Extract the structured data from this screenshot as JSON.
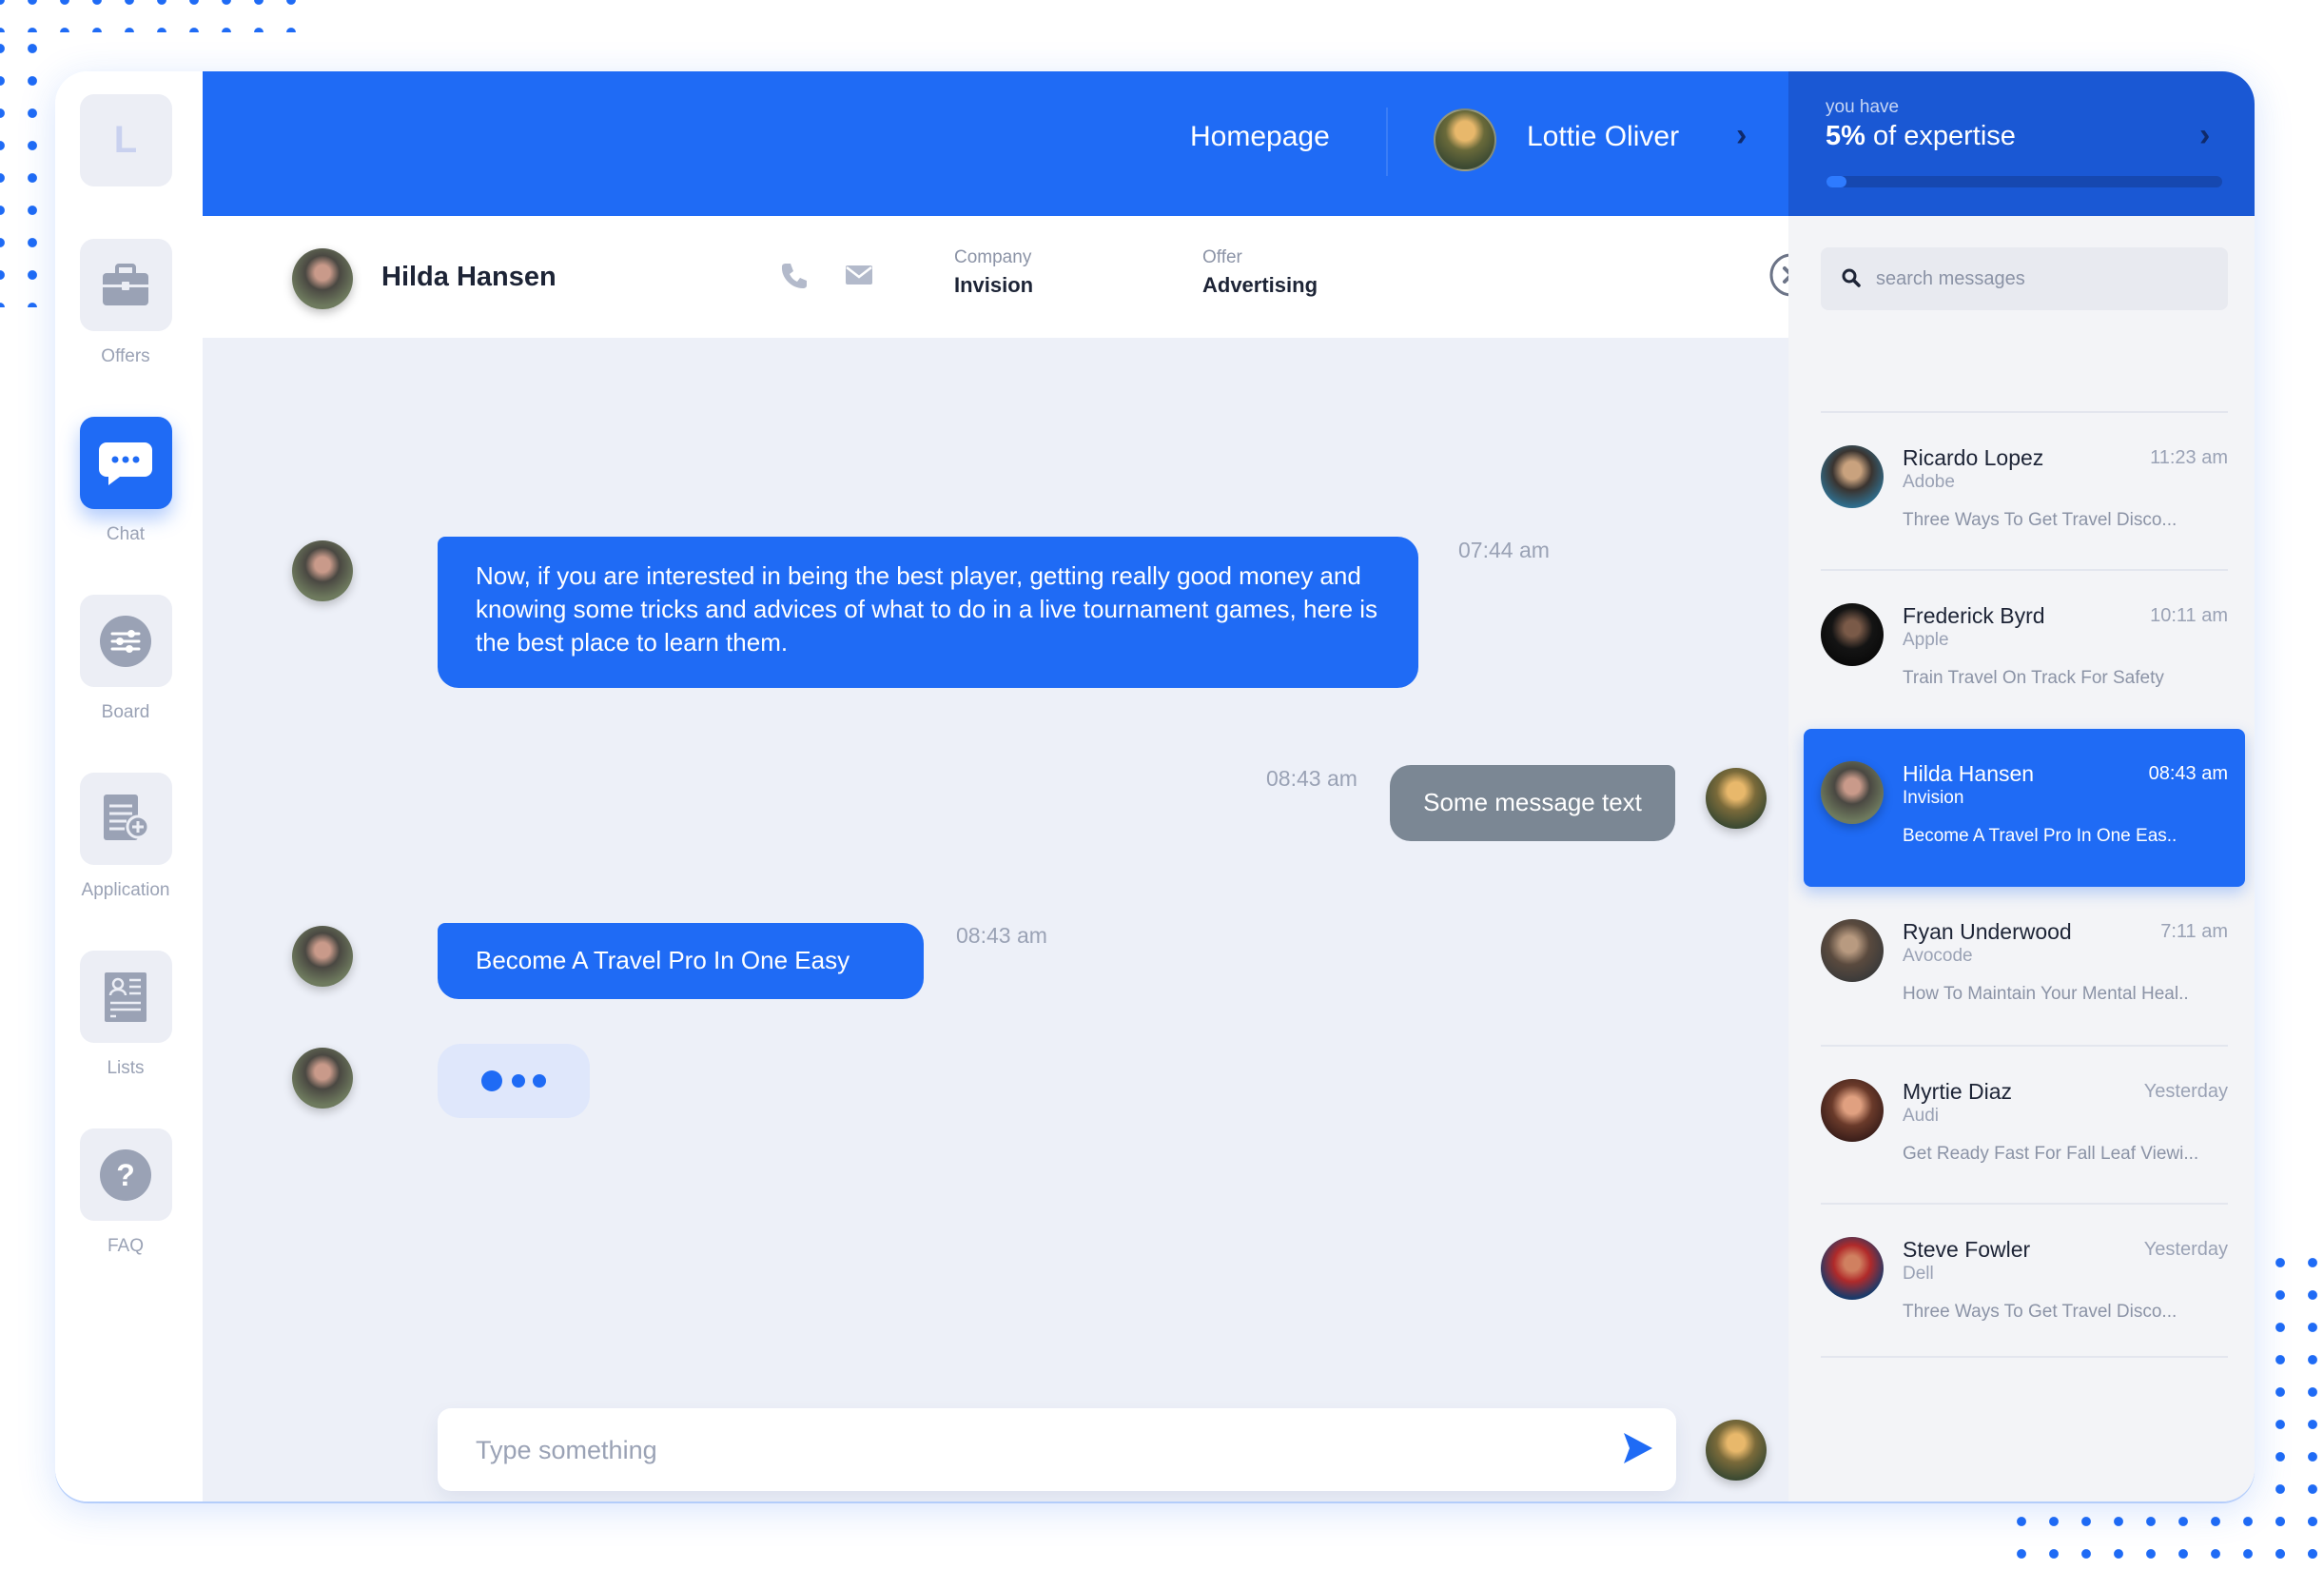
{
  "nav": {
    "logo_letter": "L",
    "items": [
      {
        "label": "Offers",
        "icon": "briefcase-icon"
      },
      {
        "label": "Chat",
        "icon": "chat-bubble-icon"
      },
      {
        "label": "Board",
        "icon": "sliders-icon"
      },
      {
        "label": "Application",
        "icon": "document-add-icon"
      },
      {
        "label": "Lists",
        "icon": "contact-card-icon"
      },
      {
        "label": "FAQ",
        "icon": "question-icon"
      }
    ],
    "active": "Chat"
  },
  "header": {
    "homepage_label": "Homepage",
    "user_name": "Lottie Oliver",
    "expertise_small": "you have",
    "expertise_percent": "5%",
    "expertise_text": " of expertise",
    "expertise_progress": 0.05
  },
  "contact": {
    "name": "Hilda Hansen",
    "company_label": "Company",
    "company_value": "Invision",
    "offer_label": "Offer",
    "offer_value": "Advertising"
  },
  "messages": [
    {
      "text": "Now, if you are interested in being the best player, getting really good money and knowing some tricks and advices of what to do in a live tournament games, here is the best place to learn them.",
      "time": "07:44 am",
      "direction": "in"
    },
    {
      "text": "Some message text",
      "time": "08:43 am",
      "direction": "out"
    },
    {
      "text": "Become A Travel Pro In One Easy",
      "time": "08:43 am",
      "direction": "in"
    }
  ],
  "composer": {
    "placeholder": "Type something"
  },
  "search": {
    "placeholder": "search messages"
  },
  "conversations": [
    {
      "name": "Ricardo Lopez",
      "time": "11:23 am",
      "company": "Adobe",
      "preview": "Three Ways To Get Travel Disco..."
    },
    {
      "name": "Frederick Byrd",
      "time": "10:11 am",
      "company": "Apple",
      "preview": "Train Travel On Track For Safety"
    },
    {
      "name": "Hilda Hansen",
      "time": "08:43 am",
      "company": "Invision",
      "preview": "Become A Travel Pro In One Eas..",
      "active": true
    },
    {
      "name": "Ryan Underwood",
      "time": "7:11 am",
      "company": "Avocode",
      "preview": "How To Maintain Your Mental Heal.."
    },
    {
      "name": "Myrtie Diaz",
      "time": "Yesterday",
      "company": "Audi",
      "preview": "Get Ready Fast For Fall Leaf Viewi..."
    },
    {
      "name": "Steve Fowler",
      "time": "Yesterday",
      "company": "Dell",
      "preview": "Three Ways To Get Travel Disco..."
    }
  ],
  "colors": {
    "primary": "#1f6bf5",
    "expertise_panel": "#1a58d4",
    "chat_bg": "#edf0f8",
    "outgoing_bubble": "#7b8794"
  }
}
